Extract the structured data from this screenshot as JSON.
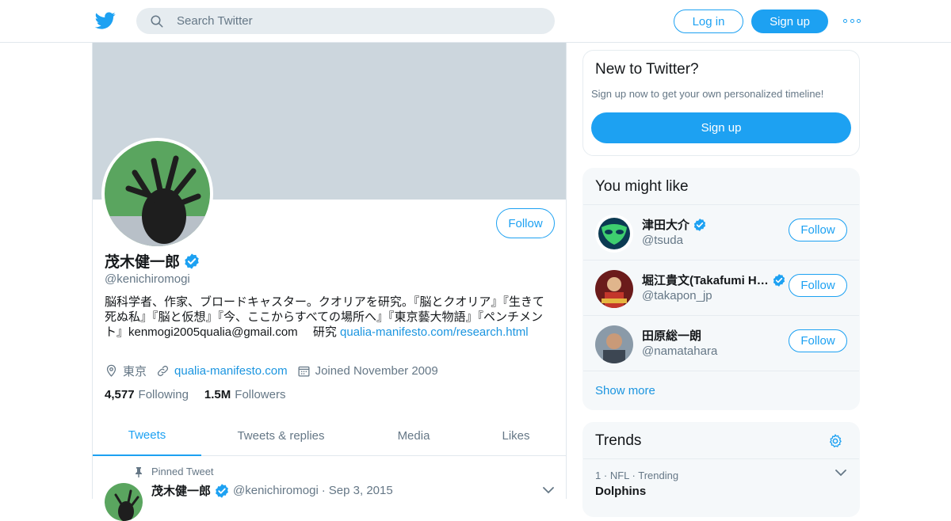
{
  "colors": {
    "accent": "#1da1f2",
    "banner": "#ccd6dd",
    "muted": "#657786",
    "text": "#14171a"
  },
  "topnav": {
    "logo_icon": "twitter-bird-icon",
    "search_placeholder": "Search Twitter",
    "login_label": "Log in",
    "signup_label": "Sign up",
    "more_icon": "more-dots-icon"
  },
  "profile": {
    "name": "茂木健一郎",
    "handle": "@kenichiromogi",
    "follow_label": "Follow",
    "bio_text": "脳科学者、作家、ブロードキャスター。クオリアを研究。『脳とクオリア』『生きて死ぬ私』『脳と仮想』『今、ここからすべての場所へ』『東京藝大物語』『ペンチメント』kenmogi2005qualia@gmail.com　 研究 ",
    "bio_link": "qualia-manifesto.com/research.html",
    "location": "東京",
    "website": "qualia-manifesto.com",
    "joined": "Joined November 2009",
    "following_count": "4,577",
    "following_label": "Following",
    "followers_count": "1.5M",
    "followers_label": "Followers",
    "tabs": [
      "Tweets",
      "Tweets & replies",
      "Media",
      "Likes"
    ]
  },
  "pinned_tweet": {
    "pinned_label": "Pinned Tweet",
    "name": "茂木健一郎",
    "handle": "@kenichiromogi",
    "date": "Sep 3, 2015"
  },
  "new_to_twitter": {
    "title": "New to Twitter?",
    "subtitle": "Sign up now to get your own personalized timeline!",
    "signup_label": "Sign up"
  },
  "you_might_like": {
    "title": "You might like",
    "suggestions": [
      {
        "name": "津田大介",
        "handle": "@tsuda",
        "follow": "Follow"
      },
      {
        "name": "堀江貴文(Takafumi Horie)",
        "handle": "@takapon_jp",
        "follow": "Follow"
      },
      {
        "name": "田原総一朗",
        "handle": "@namatahara",
        "follow": "Follow"
      }
    ],
    "show_more": "Show more"
  },
  "trends": {
    "title": "Trends",
    "items": [
      {
        "rank": "1",
        "category": "NFL",
        "status": "Trending",
        "name": "Dolphins"
      }
    ]
  }
}
